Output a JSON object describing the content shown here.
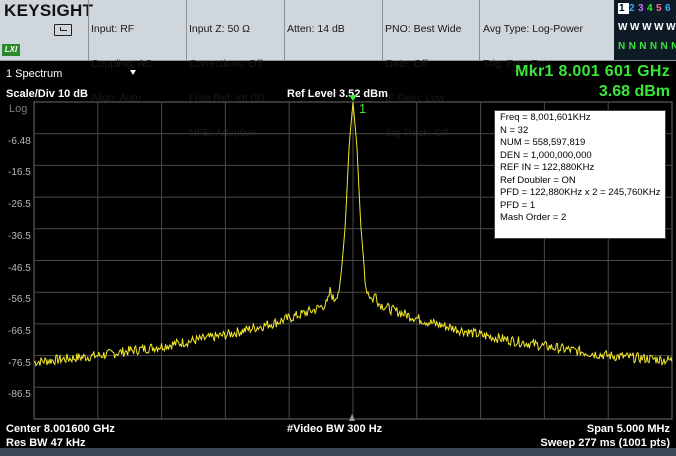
{
  "header": {
    "logo": "KEYSIGHT",
    "lxi": "LXI",
    "col1": [
      "Input: RF",
      "Coupling: AC",
      "Align: Auto"
    ],
    "col2": [
      "Input Z: 50 Ω",
      "Corrections: Off",
      "Freq Ref: Int (S)",
      "NFE: Adaptive"
    ],
    "col3": [
      "Atten: 14 dB"
    ],
    "col4": [
      "PNO: Best Wide",
      "Gate: Off",
      "IF Gain: Low",
      "Sig Track: Off"
    ],
    "col5": [
      "Avg Type: Log-Power",
      "Trig: Free Run"
    ],
    "traces": {
      "numbers": [
        "1",
        "2",
        "3",
        "4",
        "5",
        "6"
      ],
      "number_colors": [
        "#ffe64d",
        "#3fa9ff",
        "#c86bff",
        "#39e639",
        "#ff6b9a",
        "#3fa9ff"
      ],
      "types": "WWWWWW",
      "detectors": "NNNNNN"
    }
  },
  "window": {
    "label": "1 Spectrum"
  },
  "marker": {
    "title": "Mkr1  8.001 601 GHz",
    "value": "3.68 dBm",
    "label": "1"
  },
  "scale": "Scale/Div 10 dB",
  "ref_level": "Ref Level 3.52 dBm",
  "log_label": "Log",
  "info_box": [
    "Freq = 8,001,601KHz",
    "N = 32",
    "NUM =  558,597,819",
    "DEN = 1,000,000,000",
    "REF IN = 122,880KHz",
    "Ref Doubler = ON",
    "PFD = 122,880KHz x 2 = 245,760KHz",
    "PFD = 1",
    "Mash Order = 2"
  ],
  "footer": {
    "center": "Center 8.001600 GHz",
    "res_bw": "Res BW 47 kHz",
    "video_bw": "#Video BW 300 Hz",
    "span": "Span 5.000 MHz",
    "sweep": "Sweep 277 ms (1001 pts)"
  },
  "chart_data": {
    "type": "line",
    "y_tick_labels": [
      "-6.48",
      "-16.5",
      "-26.5",
      "-36.5",
      "-46.5",
      "-56.5",
      "-66.5",
      "-76.5",
      "-86.5"
    ],
    "ylim": [
      -96.48,
      3.52
    ],
    "x_range_mhz": [
      -2.5,
      2.5
    ],
    "grid": true,
    "trace_color": "#f2e82a",
    "series": [
      {
        "x": [
          -2.5,
          -2.0,
          -1.5,
          -1.0,
          -0.6,
          -0.3,
          -0.2,
          -0.18,
          -0.15,
          -0.1,
          -0.06,
          -0.03,
          0.0,
          0.03,
          0.06,
          0.1,
          0.15,
          0.18,
          0.2,
          0.3,
          0.6,
          1.0,
          1.5,
          2.0,
          2.5
        ],
        "y": [
          -78.5,
          -76.5,
          -73.5,
          -70.0,
          -66.0,
          -62.0,
          -60.0,
          -56.0,
          -59.0,
          -55.0,
          -35.0,
          -10.0,
          3.5,
          -10.0,
          -35.0,
          -55.0,
          -59.0,
          -57.0,
          -60.0,
          -62.0,
          -66.0,
          -70.0,
          -73.5,
          -76.5,
          -78.0
        ]
      }
    ]
  }
}
